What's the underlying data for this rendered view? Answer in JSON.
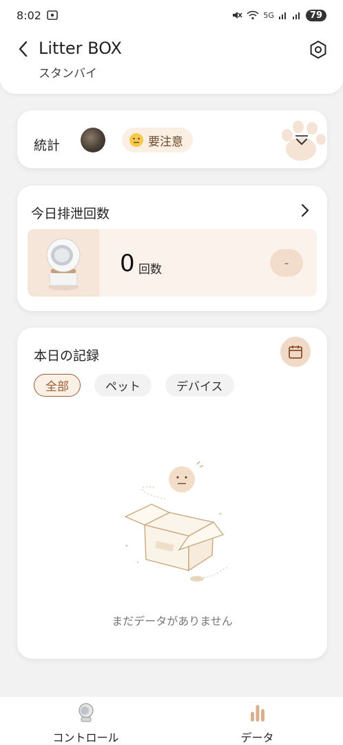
{
  "status_bar": {
    "time": "8:02",
    "network": "5G",
    "battery": "79"
  },
  "header": {
    "title": "Litter BOX",
    "subtitle": "スタンバイ"
  },
  "stats": {
    "label": "統計",
    "warning": "要注意"
  },
  "count": {
    "title": "今日排泄回数",
    "value": "0",
    "unit": "回数",
    "action_label": "-"
  },
  "records": {
    "title": "本日の記録",
    "filters": [
      "全部",
      "ペット",
      "デバイス"
    ],
    "selected_filter": "全部",
    "empty_text": "まだデータがありません"
  },
  "nav": {
    "items": [
      {
        "label": "コントロール",
        "icon": "device-icon"
      },
      {
        "label": "データ",
        "icon": "bar-chart-icon"
      }
    ]
  },
  "colors": {
    "accent": "#9a5a34",
    "accent_light": "#fbeee2",
    "background": "#f2f2f2"
  }
}
